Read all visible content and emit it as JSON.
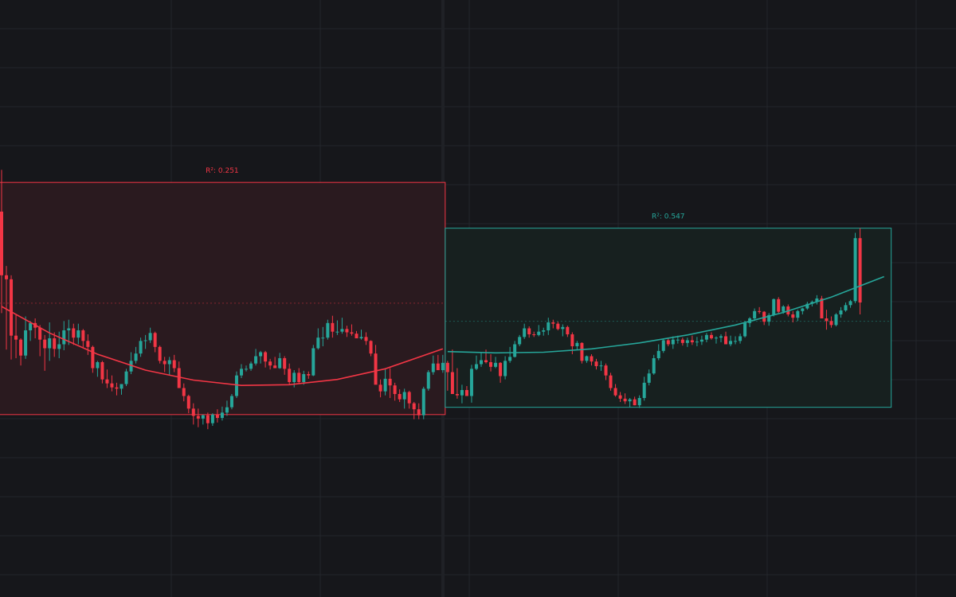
{
  "colors": {
    "background": "#16171b",
    "grid": "#23252b",
    "up": "#26a69a",
    "down": "#f23645",
    "region_down_fill": "#2a1a1f",
    "region_up_fill": "#17201f"
  },
  "chart_data": {
    "type": "candlestick",
    "grid": true,
    "regions": [
      {
        "id": "left",
        "r2_label": "R²: 0.251",
        "trend": "down",
        "bar_start": 0,
        "bar_end": 92,
        "price_high": 94.5,
        "price_low": 59.5,
        "fit_curve": [
          [
            0,
            75.8
          ],
          [
            10,
            71.8
          ],
          [
            20,
            68.6
          ],
          [
            30,
            66.2
          ],
          [
            40,
            64.7
          ],
          [
            50,
            63.9
          ],
          [
            60,
            64.0
          ],
          [
            70,
            64.8
          ],
          [
            80,
            66.4
          ],
          [
            92,
            69.4
          ]
        ]
      },
      {
        "id": "right",
        "r2_label": "R²: 0.547",
        "trend": "up",
        "bar_start": 93,
        "bar_end": 185,
        "price_high": 87.6,
        "price_low": 60.6,
        "fit_curve": [
          [
            93,
            69.0
          ],
          [
            103,
            68.8
          ],
          [
            113,
            68.9
          ],
          [
            123,
            69.4
          ],
          [
            133,
            70.3
          ],
          [
            143,
            71.5
          ],
          [
            153,
            73.0
          ],
          [
            163,
            74.9
          ],
          [
            173,
            77.2
          ],
          [
            184,
            80.3
          ]
        ]
      }
    ],
    "candles": [
      [
        90.1,
        96.4,
        74.8,
        80.5
      ],
      [
        80.5,
        81.9,
        69.3,
        79.9
      ],
      [
        79.9,
        80.5,
        67.8,
        71.4
      ],
      [
        71.4,
        74.5,
        68.0,
        70.8
      ],
      [
        70.8,
        71.0,
        66.9,
        68.4
      ],
      [
        68.4,
        74.3,
        67.9,
        72.2
      ],
      [
        72.2,
        73.6,
        70.6,
        73.3
      ],
      [
        73.3,
        74.0,
        71.0,
        72.6
      ],
      [
        72.6,
        73.0,
        68.3,
        70.8
      ],
      [
        70.8,
        71.5,
        66.1,
        69.5
      ],
      [
        69.5,
        73.4,
        67.6,
        71.0
      ],
      [
        71.0,
        71.9,
        68.2,
        69.4
      ],
      [
        69.4,
        72.0,
        68.0,
        70.1
      ],
      [
        70.1,
        73.6,
        69.2,
        72.2
      ],
      [
        72.2,
        73.8,
        70.0,
        72.5
      ],
      [
        72.5,
        73.2,
        70.0,
        71.1
      ],
      [
        71.1,
        73.2,
        70.1,
        72.2
      ],
      [
        72.2,
        72.4,
        69.5,
        70.6
      ],
      [
        70.6,
        71.6,
        68.5,
        69.7
      ],
      [
        69.7,
        69.9,
        65.8,
        66.5
      ],
      [
        66.5,
        67.6,
        65.2,
        67.4
      ],
      [
        67.4,
        67.6,
        64.2,
        64.8
      ],
      [
        64.8,
        66.3,
        63.5,
        64.2
      ],
      [
        64.2,
        65.4,
        63.0,
        63.6
      ],
      [
        63.6,
        64.3,
        62.4,
        63.4
      ],
      [
        63.4,
        64.0,
        62.5,
        64.1
      ],
      [
        64.1,
        66.4,
        63.8,
        66.0
      ],
      [
        66.0,
        68.9,
        65.6,
        67.6
      ],
      [
        67.6,
        69.7,
        67.2,
        68.7
      ],
      [
        68.7,
        71.1,
        68.2,
        70.6
      ],
      [
        70.6,
        71.5,
        69.4,
        70.7
      ],
      [
        70.7,
        72.6,
        70.3,
        71.8
      ],
      [
        71.8,
        72.0,
        68.9,
        69.7
      ],
      [
        69.7,
        69.9,
        67.2,
        67.6
      ],
      [
        67.6,
        68.2,
        65.9,
        67.1
      ],
      [
        67.1,
        68.2,
        65.5,
        67.7
      ],
      [
        67.7,
        68.5,
        65.9,
        66.5
      ],
      [
        66.5,
        67.5,
        63.6,
        63.5
      ],
      [
        63.5,
        64.2,
        61.5,
        62.3
      ],
      [
        62.3,
        62.5,
        59.7,
        60.4
      ],
      [
        60.4,
        61.2,
        58.0,
        59.3
      ],
      [
        59.3,
        60.4,
        57.6,
        58.9
      ],
      [
        58.9,
        59.5,
        58.0,
        59.4
      ],
      [
        59.4,
        59.8,
        57.3,
        58.2
      ],
      [
        58.2,
        59.7,
        57.8,
        59.5
      ],
      [
        59.5,
        60.3,
        58.3,
        59.0
      ],
      [
        59.0,
        60.7,
        58.6,
        59.8
      ],
      [
        59.8,
        61.6,
        59.3,
        60.6
      ],
      [
        60.6,
        62.6,
        60.3,
        62.3
      ],
      [
        62.3,
        66.0,
        62.0,
        65.4
      ],
      [
        65.4,
        67.1,
        65.0,
        66.4
      ],
      [
        66.4,
        66.9,
        66.0,
        66.4
      ],
      [
        66.4,
        67.5,
        66.1,
        67.2
      ],
      [
        67.2,
        69.4,
        66.9,
        68.3
      ],
      [
        68.3,
        69.1,
        67.2,
        68.9
      ],
      [
        68.9,
        69.1,
        66.6,
        67.5
      ],
      [
        67.5,
        67.9,
        66.3,
        66.9
      ],
      [
        66.9,
        68.2,
        66.6,
        66.5
      ],
      [
        66.5,
        68.8,
        66.4,
        68.0
      ],
      [
        68.0,
        68.3,
        65.5,
        66.4
      ],
      [
        66.4,
        67.2,
        64.0,
        64.4
      ],
      [
        64.4,
        66.2,
        63.6,
        65.8
      ],
      [
        65.8,
        66.5,
        64.2,
        64.4
      ],
      [
        64.4,
        66.1,
        64.0,
        65.6
      ],
      [
        65.6,
        66.0,
        64.9,
        65.4
      ],
      [
        65.4,
        70.0,
        65.3,
        69.5
      ],
      [
        69.5,
        72.5,
        69.3,
        71.1
      ],
      [
        71.1,
        72.7,
        69.8,
        71.1
      ],
      [
        71.1,
        73.8,
        70.8,
        73.3
      ],
      [
        73.3,
        74.4,
        71.1,
        72.0
      ],
      [
        72.0,
        73.7,
        71.5,
        72.0
      ],
      [
        72.0,
        74.1,
        71.7,
        72.4
      ],
      [
        72.4,
        72.9,
        71.2,
        71.9
      ],
      [
        71.9,
        73.1,
        71.4,
        71.7
      ],
      [
        71.7,
        72.1,
        71.0,
        71.0
      ],
      [
        71.0,
        72.3,
        70.8,
        71.2
      ],
      [
        71.2,
        71.9,
        70.0,
        70.6
      ],
      [
        70.6,
        70.7,
        68.3,
        68.7
      ],
      [
        68.7,
        70.0,
        64.3,
        64.0
      ],
      [
        64.0,
        64.8,
        62.1,
        63.0
      ],
      [
        63.0,
        66.5,
        62.4,
        64.9
      ],
      [
        64.9,
        66.5,
        62.0,
        63.9
      ],
      [
        63.9,
        64.3,
        61.6,
        62.6
      ],
      [
        62.6,
        63.3,
        61.4,
        61.8
      ],
      [
        61.8,
        63.4,
        60.4,
        62.9
      ],
      [
        62.9,
        63.1,
        60.4,
        61.2
      ],
      [
        61.2,
        61.4,
        58.8,
        60.3
      ],
      [
        60.3,
        61.2,
        58.8,
        59.4
      ],
      [
        59.4,
        63.7,
        58.8,
        63.4
      ],
      [
        63.4,
        66.2,
        63.1,
        65.9
      ],
      [
        65.9,
        68.4,
        65.5,
        67.2
      ],
      [
        67.2,
        68.5,
        66.3,
        66.2
      ],
      [
        66.2,
        68.5,
        65.8,
        67.3
      ],
      [
        67.3,
        67.6,
        63.1,
        65.9
      ],
      [
        65.9,
        69.3,
        63.3,
        62.6
      ],
      [
        62.6,
        66.5,
        61.9,
        62.4
      ],
      [
        62.4,
        64.0,
        61.2,
        63.2
      ],
      [
        63.2,
        63.8,
        62.3,
        62.3
      ],
      [
        62.3,
        67.0,
        61.3,
        66.4
      ],
      [
        66.4,
        68.4,
        66.2,
        67.1
      ],
      [
        67.1,
        68.9,
        66.7,
        67.7
      ],
      [
        67.7,
        69.3,
        67.2,
        67.4
      ],
      [
        67.4,
        68.6,
        66.0,
        66.7
      ],
      [
        66.7,
        68.2,
        66.5,
        67.3
      ],
      [
        67.3,
        67.4,
        64.3,
        65.3
      ],
      [
        65.3,
        68.3,
        64.8,
        67.6
      ],
      [
        67.6,
        69.7,
        67.3,
        68.2
      ],
      [
        68.2,
        70.6,
        68.1,
        70.1
      ],
      [
        70.1,
        71.5,
        69.8,
        71.2
      ],
      [
        71.2,
        73.2,
        70.9,
        72.5
      ],
      [
        72.5,
        72.8,
        71.1,
        71.6
      ],
      [
        71.6,
        72.0,
        71.2,
        71.5
      ],
      [
        71.5,
        73.0,
        71.3,
        72.0
      ],
      [
        72.0,
        72.6,
        71.4,
        72.2
      ],
      [
        72.2,
        74.1,
        71.5,
        73.4
      ],
      [
        73.4,
        73.8,
        72.5,
        73.2
      ],
      [
        73.2,
        73.5,
        72.2,
        72.4
      ],
      [
        72.4,
        73.1,
        71.3,
        72.7
      ],
      [
        72.7,
        72.9,
        71.2,
        71.6
      ],
      [
        71.6,
        71.9,
        68.6,
        69.8
      ],
      [
        69.8,
        70.6,
        69.3,
        70.3
      ],
      [
        70.3,
        70.4,
        67.2,
        67.6
      ],
      [
        67.6,
        68.4,
        67.3,
        68.3
      ],
      [
        68.3,
        68.6,
        66.9,
        67.5
      ],
      [
        67.5,
        67.9,
        66.3,
        66.8
      ],
      [
        66.8,
        67.6,
        66.1,
        66.9
      ],
      [
        66.9,
        67.2,
        64.7,
        65.4
      ],
      [
        65.4,
        65.8,
        63.1,
        63.5
      ],
      [
        63.5,
        64.1,
        62.2,
        62.4
      ],
      [
        62.4,
        62.9,
        61.4,
        61.9
      ],
      [
        61.9,
        62.7,
        61.1,
        61.5
      ],
      [
        61.5,
        62.0,
        60.6,
        61.8
      ],
      [
        61.8,
        62.2,
        60.9,
        60.9
      ],
      [
        60.9,
        62.4,
        60.5,
        62.0
      ],
      [
        62.0,
        65.2,
        61.6,
        64.3
      ],
      [
        64.3,
        66.3,
        63.9,
        65.7
      ],
      [
        65.7,
        68.5,
        65.5,
        68.0
      ],
      [
        68.0,
        70.1,
        67.7,
        69.1
      ],
      [
        69.1,
        71.0,
        68.8,
        70.7
      ],
      [
        70.7,
        71.0,
        69.8,
        70.1
      ],
      [
        70.1,
        71.3,
        69.4,
        70.8
      ],
      [
        70.8,
        71.4,
        70.2,
        70.8
      ],
      [
        70.8,
        71.1,
        69.9,
        70.3
      ],
      [
        70.3,
        71.1,
        69.7,
        70.7
      ],
      [
        70.7,
        71.4,
        70.0,
        70.4
      ],
      [
        70.4,
        71.2,
        69.8,
        70.5
      ],
      [
        70.5,
        71.4,
        70.0,
        70.8
      ],
      [
        70.8,
        71.8,
        70.4,
        71.5
      ],
      [
        71.5,
        71.9,
        70.8,
        71.0
      ],
      [
        71.0,
        71.3,
        70.2,
        71.1
      ],
      [
        71.1,
        71.6,
        70.4,
        71.3
      ],
      [
        71.3,
        72.0,
        70.8,
        70.1
      ],
      [
        70.1,
        71.4,
        69.8,
        70.6
      ],
      [
        70.6,
        71.3,
        70.1,
        70.6
      ],
      [
        70.6,
        71.7,
        70.2,
        71.3
      ],
      [
        71.3,
        73.6,
        71.1,
        73.3
      ],
      [
        73.3,
        74.2,
        72.7,
        74.0
      ],
      [
        74.0,
        75.5,
        73.6,
        75.1
      ],
      [
        75.1,
        75.7,
        74.7,
        75.0
      ],
      [
        75.0,
        75.1,
        73.0,
        73.5
      ],
      [
        73.5,
        74.8,
        72.9,
        74.5
      ],
      [
        74.5,
        77.0,
        74.3,
        76.9
      ],
      [
        76.9,
        77.2,
        74.8,
        75.0
      ],
      [
        75.0,
        76.0,
        74.7,
        75.8
      ],
      [
        75.8,
        76.1,
        74.3,
        74.6
      ],
      [
        74.6,
        75.1,
        73.4,
        74.1
      ],
      [
        74.1,
        75.3,
        73.6,
        75.1
      ],
      [
        75.1,
        75.6,
        74.6,
        75.5
      ],
      [
        75.5,
        76.5,
        75.3,
        76.2
      ],
      [
        76.2,
        76.7,
        75.8,
        76.5
      ],
      [
        76.5,
        77.5,
        76.1,
        77.0
      ],
      [
        77.0,
        77.4,
        75.2,
        74.0
      ],
      [
        74.0,
        75.3,
        72.3,
        73.6
      ],
      [
        73.6,
        74.3,
        72.6,
        73.0
      ],
      [
        73.0,
        74.8,
        72.8,
        74.6
      ],
      [
        74.6,
        75.7,
        74.1,
        75.2
      ],
      [
        75.2,
        76.4,
        75.0,
        76.0
      ],
      [
        76.0,
        76.8,
        75.6,
        76.6
      ],
      [
        76.6,
        86.9,
        76.3,
        86.1
      ],
      [
        86.1,
        87.6,
        74.6,
        76.4
      ]
    ]
  }
}
